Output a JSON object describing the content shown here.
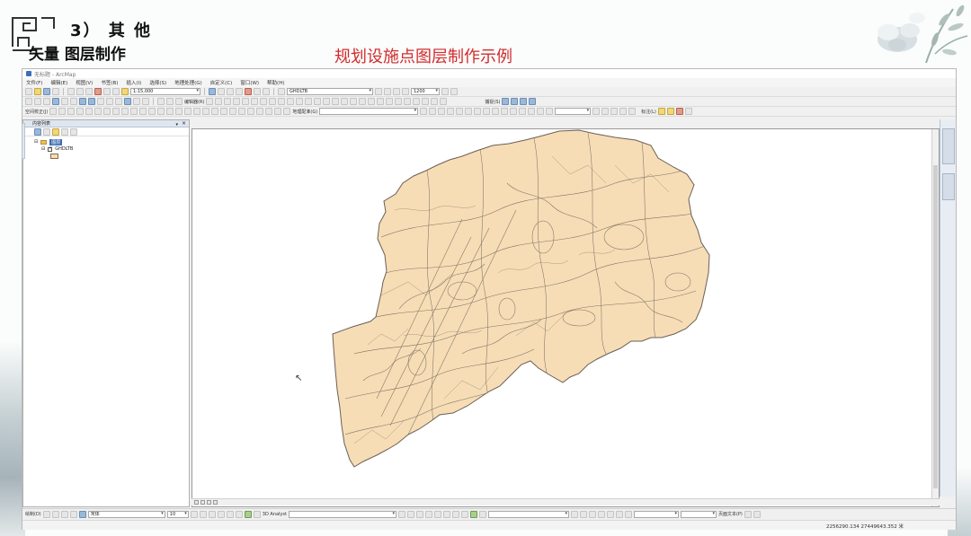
{
  "slide": {
    "heading": "3） 其 他",
    "subheading": "矢量 图层制作",
    "caption": "规划设施点图层制作示例"
  },
  "app": {
    "title": "无标题 - ArcMap",
    "menus": [
      "文件(F)",
      "编辑(E)",
      "视图(V)",
      "书签(B)",
      "插入(I)",
      "选择(S)",
      "地理处理(G)",
      "自定义(C)",
      "窗口(W)",
      "帮助(H)"
    ],
    "scale": "1:15,000",
    "layer_combo": "GHDLTB",
    "zoom_value": "1200",
    "editor_label": "编辑器(R)",
    "georef_label": "地理配准(G)",
    "spatial_adjust_label": "空间校正(J)",
    "snapping_label": "捕捉(S)",
    "label_tools": "标注(L)",
    "drawing_label": "绘制(D)",
    "font_name": "宋体",
    "font_size": "10",
    "analyst_label": "3D Analyst",
    "text_label": "页面文本(P)",
    "coords": "2256290.134  27449643.352 米"
  },
  "toc": {
    "title": "内容列表",
    "dataframe": "图层",
    "layer": "GHDLTB"
  },
  "colors": {
    "polygon_fill": "#f6ddb6",
    "polygon_stroke": "#6b5f55",
    "caption_red": "#d12b2b",
    "selection_blue": "#3d6db5"
  },
  "icons": [
    "arrow-cursor-icon",
    "folder-icon",
    "checkbox-icon",
    "pin-icon",
    "close-icon",
    "floral-decoration",
    "corner-logo"
  ]
}
